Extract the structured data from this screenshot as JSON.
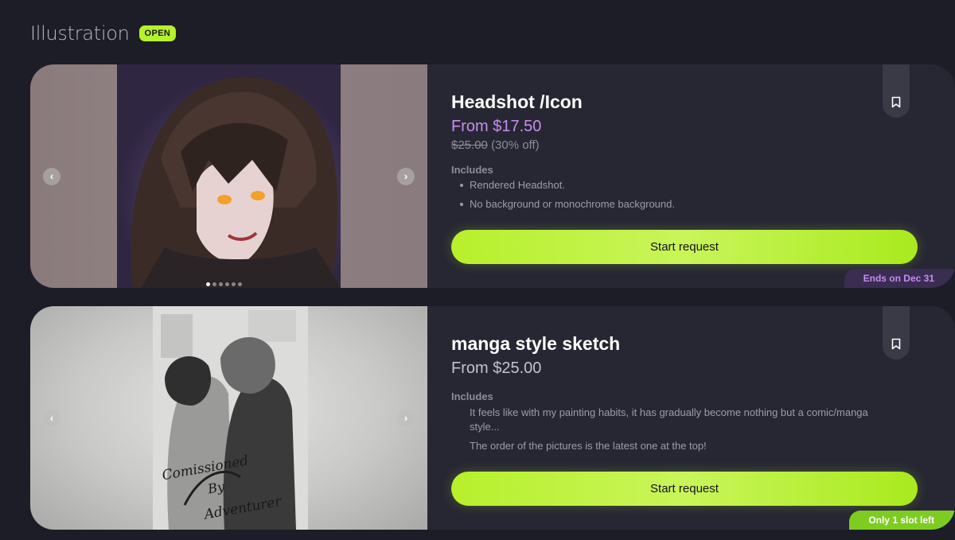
{
  "section": {
    "title": "Illustration",
    "status": "OPEN"
  },
  "cards": [
    {
      "title": "Headshot /Icon",
      "price": "From $17.50",
      "original_price": "$25.00",
      "discount": "(30% off)",
      "includes_label": "Includes",
      "includes": [
        "Rendered Headshot.",
        "No background or monochrome background."
      ],
      "button_label": "Start request",
      "tag": "Ends on Dec 31",
      "gallery": {
        "slide_count": 6,
        "active_slide": 1
      }
    },
    {
      "title": "manga style sketch",
      "price": "From $25.00",
      "includes_label": "Includes",
      "includes": [
        "It feels like with my painting habits, it has gradually become nothing but a comic/manga style...",
        "The order of the pictures is the latest one at the top!"
      ],
      "button_label": "Start request",
      "tag": "Only 1 slot left",
      "artwork_watermark": "Comissioned By Adventurer"
    }
  ],
  "icons": {
    "prev": "chevron-left-icon",
    "next": "chevron-right-icon",
    "bookmark": "bookmark-icon"
  },
  "colors": {
    "background": "#1d1d28",
    "card": "#272733",
    "accent_lime": "#b4f22a",
    "sale_purple": "#c98df0",
    "tag_purple_bg": "#3a2d52",
    "tag_green_bg": "#7dcc22"
  }
}
